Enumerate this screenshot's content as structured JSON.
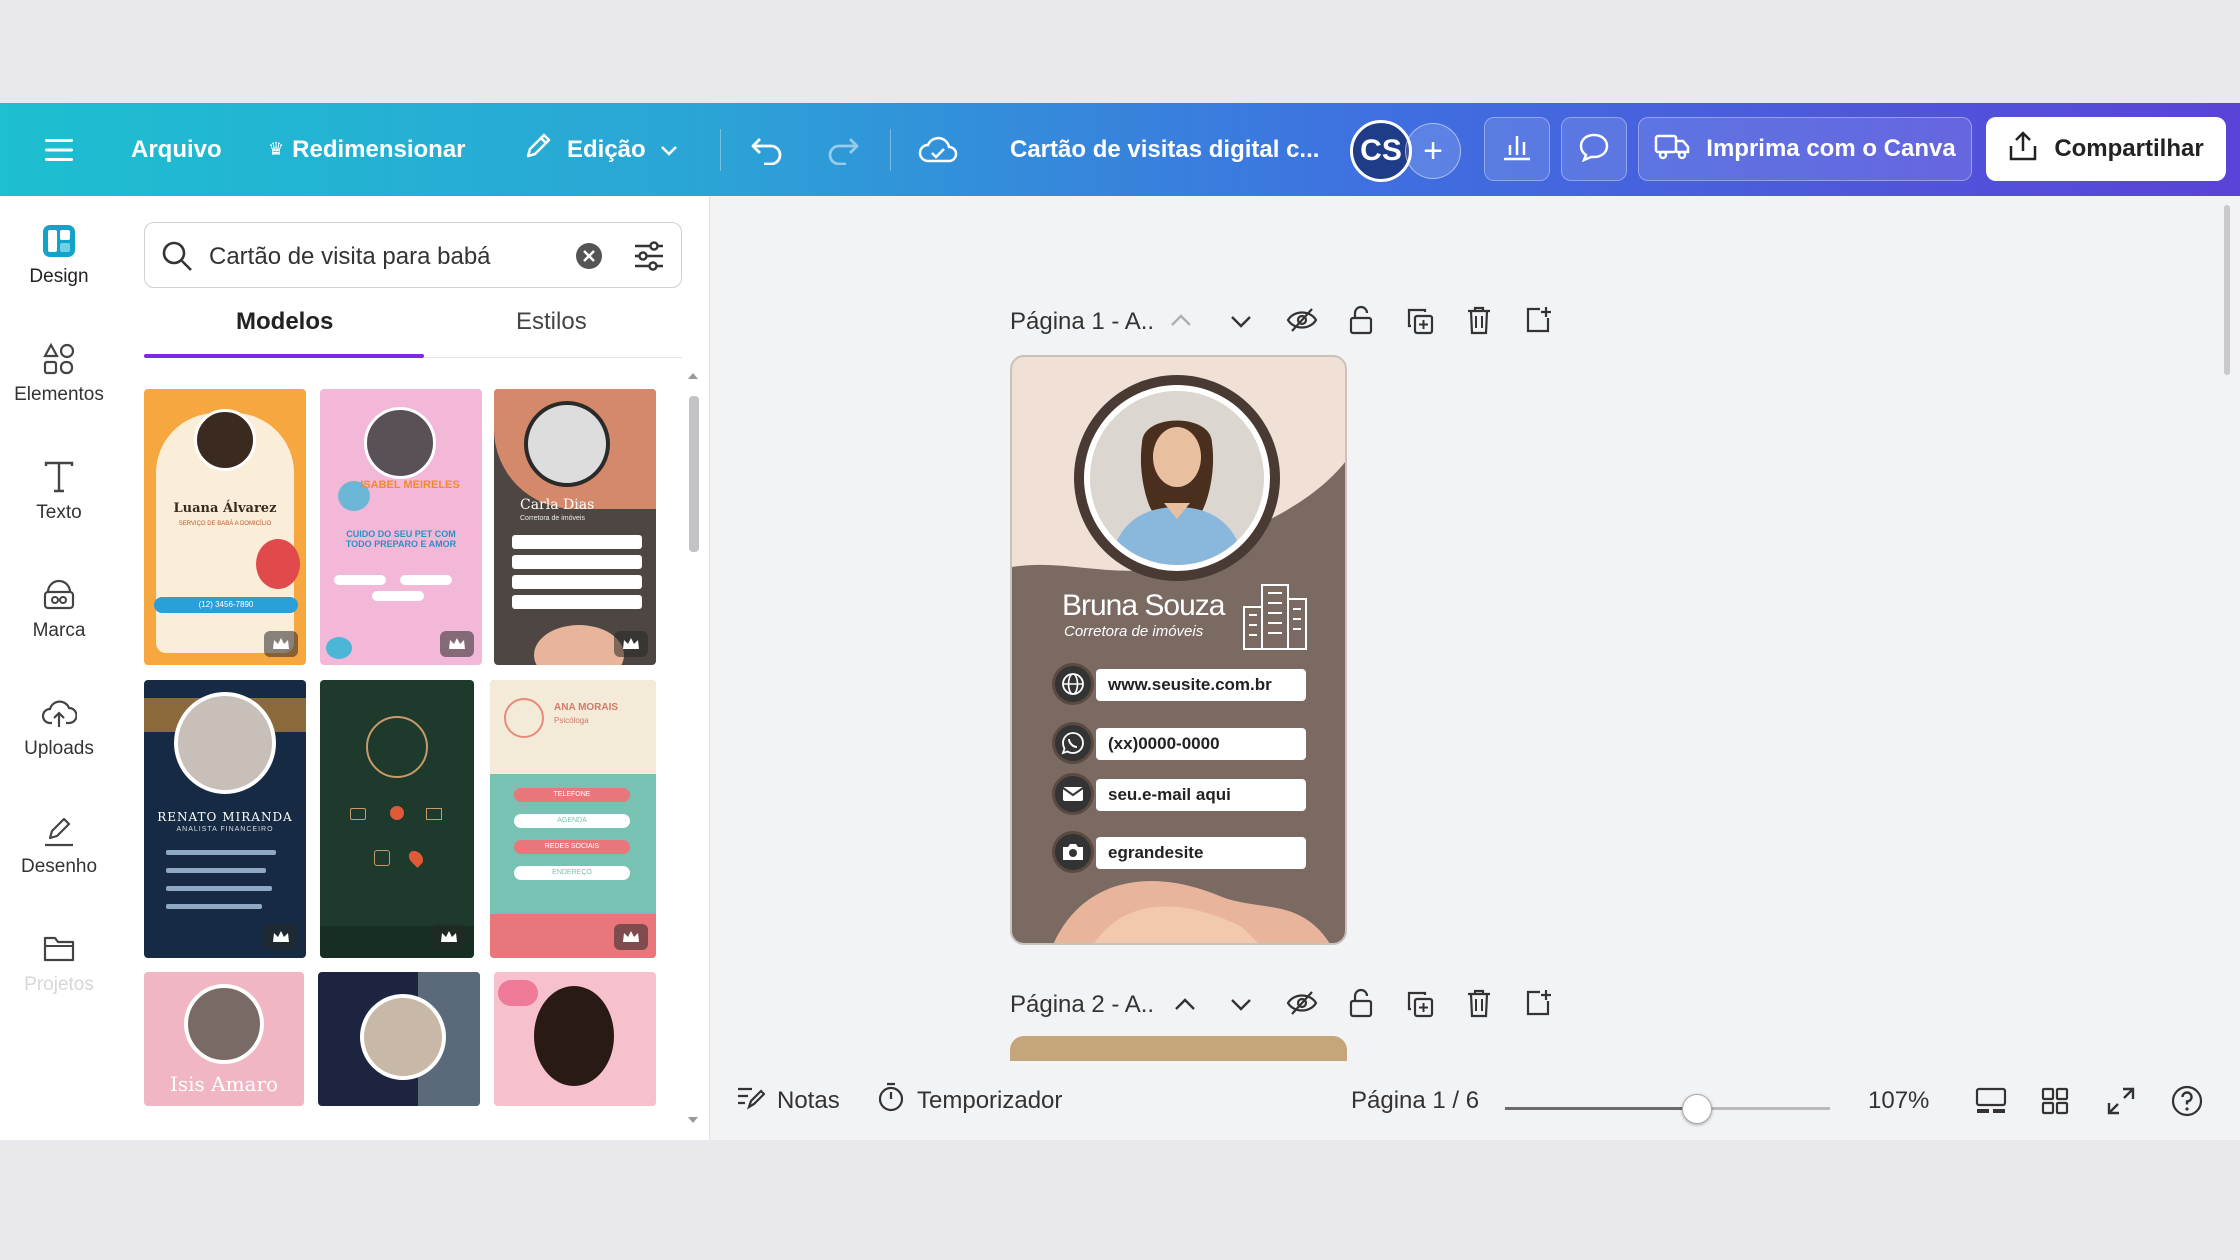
{
  "topbar": {
    "menu_icon": "hamburger-icon",
    "file": "Arquivo",
    "resize": "Redimensionar",
    "edit": "Edição",
    "title": "Cartão de visitas digital c...",
    "avatar_initials": "CS",
    "print": "Imprima com o Canva",
    "share": "Compartilhar"
  },
  "sidebar": {
    "items": [
      {
        "label": "Design",
        "icon": "design-icon"
      },
      {
        "label": "Elementos",
        "icon": "elements-icon"
      },
      {
        "label": "Texto",
        "icon": "text-icon"
      },
      {
        "label": "Marca",
        "icon": "brand-icon"
      },
      {
        "label": "Uploads",
        "icon": "uploads-icon"
      },
      {
        "label": "Desenho",
        "icon": "draw-icon"
      },
      {
        "label": "Projetos",
        "icon": "folder-icon"
      }
    ]
  },
  "panel": {
    "search_value": "Cartão de visita para babá",
    "tabs": [
      "Modelos",
      "Estilos"
    ],
    "active_tab": "Modelos",
    "templates": [
      {
        "name": "Luana Álvarez",
        "sub": "SERVIÇO DE BABÁ A DOMICÍLIO",
        "phone": "(12) 3456-7890"
      },
      {
        "name": "ISABEL MEIRELES",
        "sub": "CUIDO DO SEU PET COM TODO PREPARO E AMOR"
      },
      {
        "name": "Carla Dias",
        "sub": "Corretora de imóveis"
      },
      {
        "name": "RENATO MIRANDA",
        "sub": "ANALISTA FINANCEIRO"
      },
      {
        "name": "",
        "sub": ""
      },
      {
        "name": "ANA MORAIS",
        "sub": "Psicóloga",
        "buttons": [
          "TELEFONE",
          "AGENDA",
          "REDES SOCIAIS",
          "ENDEREÇO"
        ]
      },
      {
        "name": "Isis Amaro",
        "sub": ""
      },
      {
        "name": "",
        "sub": ""
      },
      {
        "name": "",
        "sub": ""
      }
    ]
  },
  "canvas": {
    "page1_label": "Página 1 - A..",
    "page2_label": "Página 2 - A..",
    "card": {
      "name": "Bruna Souza",
      "role": "Corretora de imóveis",
      "contacts": [
        {
          "icon": "globe-icon",
          "text": "www.seusite.com.br"
        },
        {
          "icon": "whatsapp-icon",
          "text": "(xx)0000-0000"
        },
        {
          "icon": "mail-icon",
          "text": "seu.e-mail aqui"
        },
        {
          "icon": "camera-icon",
          "text": "egrandesite"
        }
      ],
      "colors": {
        "bg": "#f0e0d6",
        "brown": "#7a6a62",
        "accent": "#e8b49b"
      }
    }
  },
  "bottombar": {
    "notes": "Notas",
    "timer": "Temporizador",
    "page_indicator": "Página 1 / 6",
    "zoom": "107%",
    "zoom_fraction": 0.59
  },
  "colors": {
    "gradient_start": "#1dbfd0",
    "gradient_end": "#5a43d8",
    "tab_accent": "#7d2ae8"
  }
}
